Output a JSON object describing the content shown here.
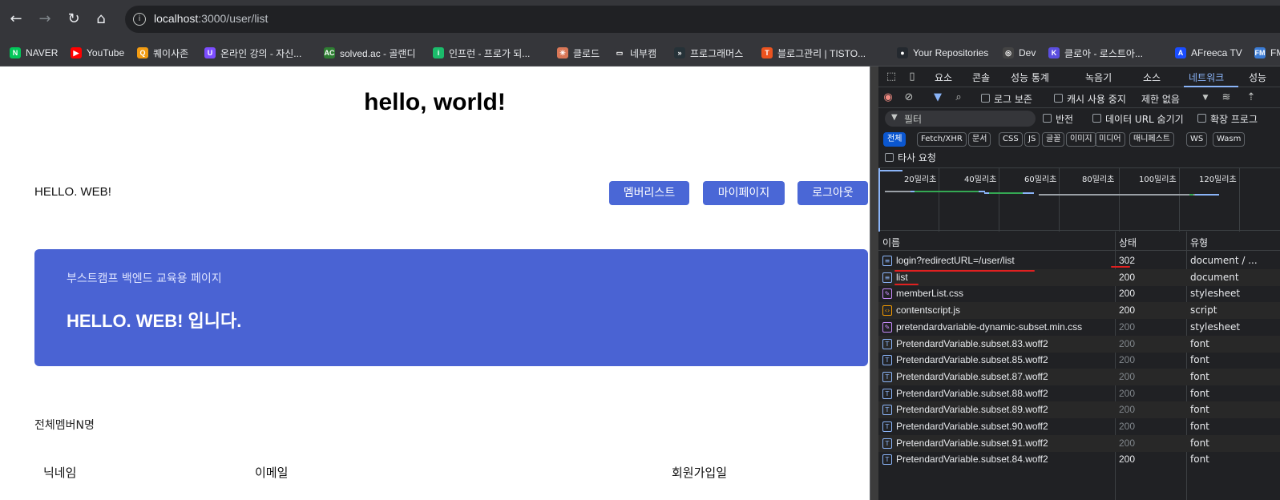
{
  "browser": {
    "url_host": "localhost",
    "url_path": ":3000/user/list",
    "bookmarks": [
      {
        "label": "NAVER",
        "color": "#03c75a",
        "glyph": "N"
      },
      {
        "label": "YouTube",
        "color": "#ff0000",
        "glyph": "▶"
      },
      {
        "label": "퀘이사존",
        "color": "#f39c12",
        "glyph": "Q"
      },
      {
        "label": "온라인 강의 - 자신...",
        "color": "#7c4dff",
        "glyph": "U"
      },
      {
        "label": "solved.ac - 골랜디",
        "color": "#2e7d32",
        "glyph": "AC"
      },
      {
        "label": "인프런 - 프로가 되...",
        "color": "#1bbc6b",
        "glyph": "i"
      },
      {
        "label": "클로드",
        "color": "#d97757",
        "glyph": "✳"
      },
      {
        "label": "네부캠",
        "color": "#35363a",
        "glyph": "▭"
      },
      {
        "label": "프로그래머스",
        "color": "#263238",
        "glyph": "»"
      },
      {
        "label": "블로그관리 | TISTO...",
        "color": "#eb531f",
        "glyph": "T"
      },
      {
        "label": "Your Repositories",
        "color": "#24292f",
        "glyph": "●"
      },
      {
        "label": "Dev",
        "color": "#444",
        "glyph": "◎"
      },
      {
        "label": "클로아 - 로스트아...",
        "color": "#5b4ee0",
        "glyph": "K"
      },
      {
        "label": "AFreeca TV",
        "color": "#1a4dff",
        "glyph": "A"
      },
      {
        "label": "FM",
        "color": "#3a7bd5",
        "glyph": "FM"
      }
    ]
  },
  "page": {
    "hello": "hello, world!",
    "brand": "HELLO. WEB!",
    "buttons": [
      "멤버리스트",
      "마이페이지",
      "로그아웃"
    ],
    "hero_sub": "부스트캠프 백엔드 교육용 페이지",
    "hero_title": "HELLO. WEB! 입니다.",
    "member_count": "전체멤버N명",
    "table_headers": [
      "닉네임",
      "이메일",
      "회원가입일"
    ]
  },
  "devtools": {
    "tabs": [
      "요소",
      "콘솔",
      "성능 통계",
      "녹음기",
      "소스",
      "네트워크",
      "성능"
    ],
    "active_tab": "네트워크",
    "preserve_log": "로그 보존",
    "disable_cache": "캐시 사용 중지",
    "throttle": "제한 없음",
    "filter_placeholder": "필터",
    "invert": "반전",
    "hide_data_urls": "데이터 URL 숨기기",
    "hide_ext": "확장 프로그",
    "chips": [
      "전체",
      "Fetch/XHR",
      "문서",
      "CSS",
      "JS",
      "글꼴",
      "이미지",
      "미디어",
      "매니페스트",
      "WS",
      "Wasm"
    ],
    "third_party": "타사 요청",
    "timeline_ticks": [
      "20밀리초",
      "40밀리초",
      "60밀리초",
      "80밀리초",
      "100밀리초",
      "120밀리초"
    ],
    "columns": [
      "이름",
      "상태",
      "유형"
    ],
    "requests": [
      {
        "name": "login?redirectURL=/user/list",
        "status": "302",
        "type": "document / ...",
        "dim": false,
        "kind": "doc"
      },
      {
        "name": "list",
        "status": "200",
        "type": "document",
        "dim": false,
        "kind": "doc"
      },
      {
        "name": "memberList.css",
        "status": "200",
        "type": "stylesheet",
        "dim": false,
        "kind": "css"
      },
      {
        "name": "contentscript.js",
        "status": "200",
        "type": "script",
        "dim": false,
        "kind": "js"
      },
      {
        "name": "pretendardvariable-dynamic-subset.min.css",
        "status": "200",
        "type": "stylesheet",
        "dim": true,
        "kind": "css"
      },
      {
        "name": "PretendardVariable.subset.83.woff2",
        "status": "200",
        "type": "font",
        "dim": true,
        "kind": "font"
      },
      {
        "name": "PretendardVariable.subset.85.woff2",
        "status": "200",
        "type": "font",
        "dim": true,
        "kind": "font"
      },
      {
        "name": "PretendardVariable.subset.87.woff2",
        "status": "200",
        "type": "font",
        "dim": true,
        "kind": "font"
      },
      {
        "name": "PretendardVariable.subset.88.woff2",
        "status": "200",
        "type": "font",
        "dim": true,
        "kind": "font"
      },
      {
        "name": "PretendardVariable.subset.89.woff2",
        "status": "200",
        "type": "font",
        "dim": true,
        "kind": "font"
      },
      {
        "name": "PretendardVariable.subset.90.woff2",
        "status": "200",
        "type": "font",
        "dim": true,
        "kind": "font"
      },
      {
        "name": "PretendardVariable.subset.91.woff2",
        "status": "200",
        "type": "font",
        "dim": true,
        "kind": "font"
      },
      {
        "name": "PretendardVariable.subset.84.woff2",
        "status": "200",
        "type": "font",
        "dim": false,
        "kind": "font"
      }
    ]
  }
}
